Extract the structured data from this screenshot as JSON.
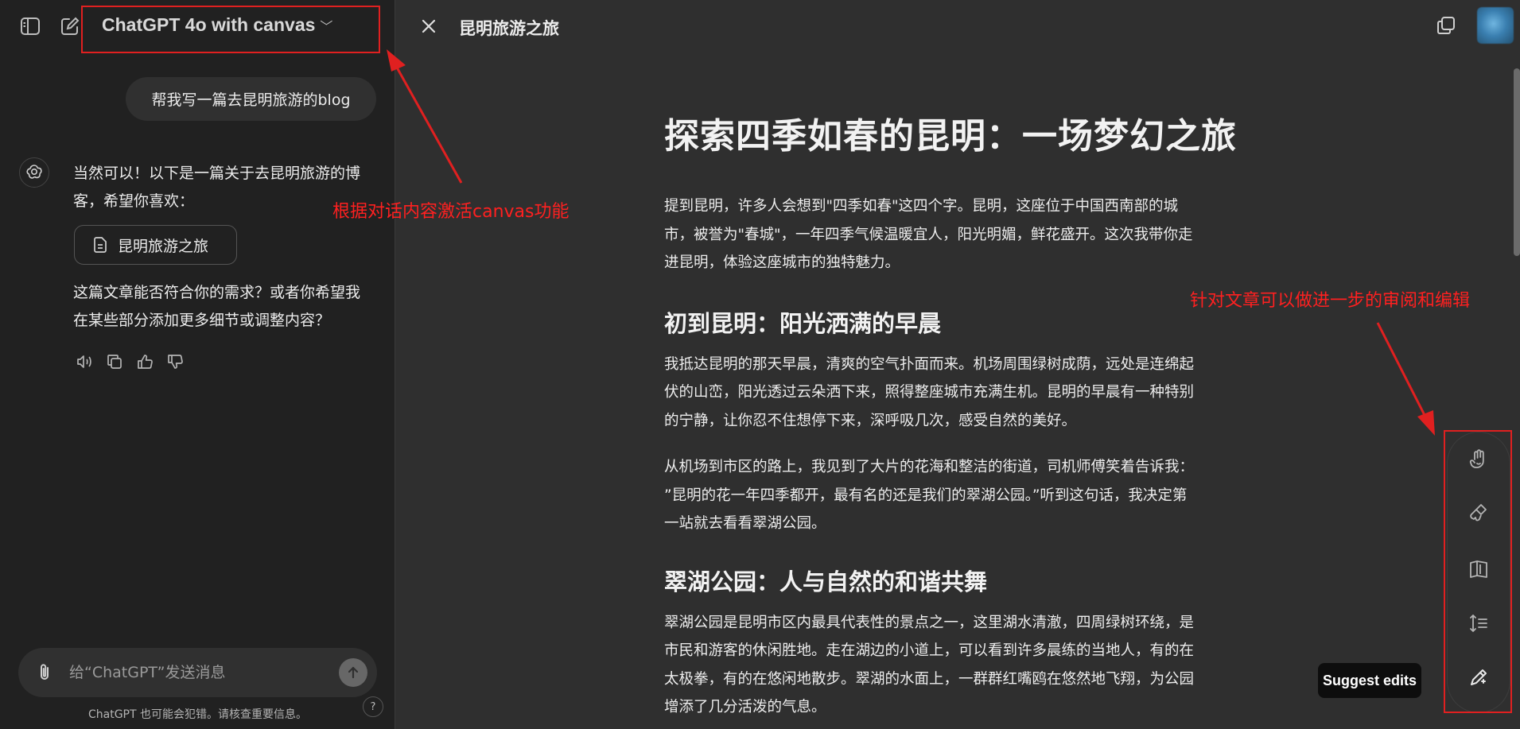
{
  "header": {
    "model_title": "ChatGPT 4o with canvas",
    "canvas_title": "昆明旅游之旅"
  },
  "chat": {
    "user_message": "帮我写一篇去昆明旅游的blog",
    "assistant_intro_lines": [
      "当然可以！以下是一篇关于去昆明旅游的博",
      "客，希望你喜欢："
    ],
    "doc_chip_label": "昆明旅游之旅",
    "assistant_outro_lines": [
      "这篇文章能否符合你的需求？或者你希望我",
      "在某些部分添加更多细节或调整内容？"
    ]
  },
  "composer": {
    "placeholder": "给“ChatGPT”发送消息",
    "disclaimer": "ChatGPT 也可能会犯错。请核查重要信息。",
    "help_label": "?"
  },
  "document": {
    "title": "探索四季如春的昆明：一场梦幻之旅",
    "intro_lines": [
      "提到昆明，许多人会想到\"四季如春\"这四个字。昆明，这座位于中国西南部的城",
      "市，被誉为\"春城\"，一年四季气候温暖宜人，阳光明媚，鲜花盛开。这次我带你走",
      "进昆明，体验这座城市的独特魅力。"
    ],
    "section1_heading": "初到昆明：阳光洒满的早晨",
    "section1_p1_lines": [
      "我抵达昆明的那天早晨，清爽的空气扑面而来。机场周围绿树成荫，远处是连绵起",
      "伏的山峦，阳光透过云朵洒下来，照得整座城市充满生机。昆明的早晨有一种特别",
      "的宁静，让你忍不住想停下来，深呼吸几次，感受自然的美好。"
    ],
    "section1_p2_lines": [
      "从机场到市区的路上，我见到了大片的花海和整洁的街道，司机师傅笑着告诉我：",
      "”昆明的花一年四季都开，最有名的还是我们的翠湖公园。”听到这句话，我决定第",
      "一站就去看看翠湖公园。"
    ],
    "section2_heading": "翠湖公园：人与自然的和谐共舞",
    "section2_p1_lines": [
      "翠湖公园是昆明市区内最具代表性的景点之一，这里湖水清澈，四周绿树环绕，是",
      "市民和游客的休闲胜地。走在湖边的小道上，可以看到许多晨练的当地人，有的在",
      "太极拳，有的在悠闲地散步。翠湖的水面上，一群群红嘴鸥在悠然地飞翔，为公园",
      "增添了几分活泼的气息。"
    ]
  },
  "toolbar": {
    "tooltip": "Suggest edits"
  },
  "annotations": {
    "left_note": "根据对话内容激活canvas功能",
    "right_note": "针对文章可以做进一步的审阅和编辑"
  },
  "colors": {
    "annotation_red": "#e02020",
    "left_panel_bg": "#212121",
    "canvas_bg": "#2f2f2f"
  }
}
